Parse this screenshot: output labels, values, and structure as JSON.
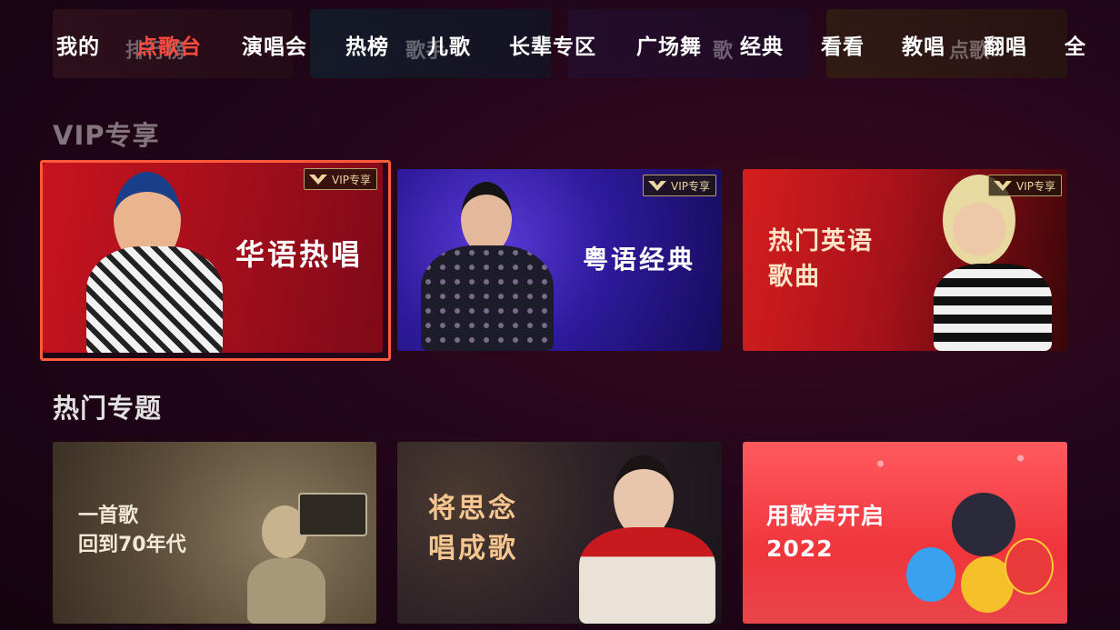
{
  "nav": {
    "items": [
      "我的",
      "点歌台",
      "演唱会",
      "热榜",
      "儿歌",
      "长辈专区",
      "广场舞",
      "经典",
      "看看",
      "教唱",
      "翻唱",
      "全"
    ],
    "active_index": 1,
    "ghost_labels": [
      "排行榜",
      "歌手",
      "歌",
      "点歌"
    ]
  },
  "sections": {
    "vip": {
      "title": "VIP专享",
      "badge": "VIP专享",
      "cards": [
        {
          "label": "华语热唱"
        },
        {
          "label": "粤语经典"
        },
        {
          "label_line1": "热门英语",
          "label_line2": "歌曲"
        }
      ]
    },
    "hot": {
      "title": "热门专题",
      "cards": [
        {
          "label_line1": "一首歌",
          "label_line2": "回到70年代"
        },
        {
          "label_line1": "将思念",
          "label_line2": "唱成歌"
        },
        {
          "label_line1": "用歌声开启",
          "label_line2": "2022"
        }
      ]
    }
  },
  "colors": {
    "accent": "#ff4b3e",
    "focus_border": "#ff5a3c",
    "vip_gold": "#e9d6a3"
  }
}
